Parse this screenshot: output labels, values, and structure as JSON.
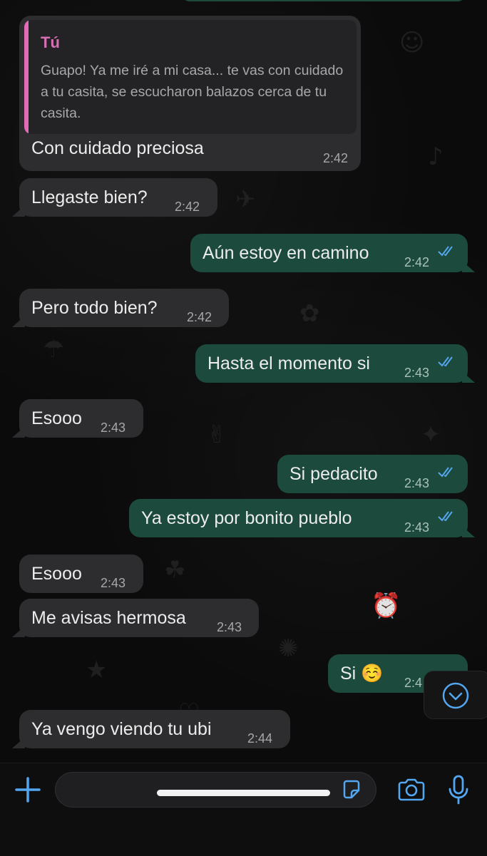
{
  "reply": {
    "quoted_author": "Tú",
    "quoted_text": "Guapo! Ya me iré a mi casa... te vas con cuidado a tu casita, se escucharon balazos cerca de tu casita.",
    "text": "Con cuidado preciosa",
    "time": "2:42"
  },
  "messages": [
    {
      "text": "Llegaste bien?",
      "time": "2:42",
      "direction": "incoming"
    },
    {
      "text": "Aún estoy en camino",
      "time": "2:42",
      "direction": "outgoing",
      "status": "read"
    },
    {
      "text": "Pero todo bien?",
      "time": "2:42",
      "direction": "incoming"
    },
    {
      "text": "Hasta el momento si",
      "time": "2:43",
      "direction": "outgoing",
      "status": "read"
    },
    {
      "text": "Esooo",
      "time": "2:43",
      "direction": "incoming"
    },
    {
      "text": "Si pedacito",
      "time": "2:43",
      "direction": "outgoing",
      "status": "read"
    },
    {
      "text": "Ya estoy por bonito pueblo",
      "time": "2:43",
      "direction": "outgoing",
      "status": "read"
    },
    {
      "text": "Esooo",
      "time": "2:43",
      "direction": "incoming"
    },
    {
      "text": "Me avisas hermosa",
      "time": "2:43",
      "direction": "incoming"
    },
    {
      "text": "Si ☺️",
      "time": "2:4",
      "direction": "outgoing"
    },
    {
      "text": "Ya vengo viendo tu ubi",
      "time": "2:44",
      "direction": "incoming"
    }
  ],
  "composer": {
    "value": "",
    "placeholder": ""
  },
  "icons": {
    "plus": "plus-icon",
    "sticker": "sticker-icon",
    "camera": "camera-icon",
    "mic": "microphone-icon",
    "scroll": "chevron-down-circle-icon",
    "read": "double-check-icon"
  },
  "colors": {
    "incoming_bubble": "#2d2d2f",
    "outgoing_bubble": "#1c4a3d",
    "accent": "#53a6f0",
    "quote_accent": "#e26ab7",
    "read_ticks": "#53a6f0"
  }
}
